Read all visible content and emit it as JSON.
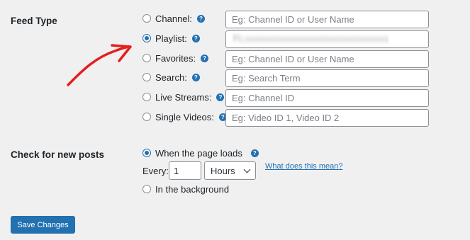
{
  "feed_type": {
    "label": "Feed Type",
    "options": [
      {
        "label": "Channel:",
        "placeholder": "Eg: Channel ID or User Name",
        "value": "",
        "checked": false
      },
      {
        "label": "Playlist:",
        "placeholder": "",
        "value": "PLxxxxxxxxxxxxxxxxxxxxxxxxxxxxx",
        "checked": true
      },
      {
        "label": "Favorites:",
        "placeholder": "Eg: Channel ID or User Name",
        "value": "",
        "checked": false
      },
      {
        "label": "Search:",
        "placeholder": "Eg: Search Term",
        "value": "",
        "checked": false
      },
      {
        "label": "Live Streams:",
        "placeholder": "Eg: Channel ID",
        "value": "",
        "checked": false
      },
      {
        "label": "Single Videos:",
        "placeholder": "Eg: Video ID 1, Video ID 2",
        "value": "",
        "checked": false
      }
    ]
  },
  "check_new_posts": {
    "label": "Check for new posts",
    "page_load": {
      "label": "When the page loads",
      "checked": true
    },
    "every_label": "Every:",
    "every_value": "1",
    "unit_selected": "Hours",
    "help_link": "What does this mean?",
    "background": {
      "label": "In the background",
      "checked": false
    }
  },
  "actions": {
    "save_label": "Save Changes"
  },
  "icons": {
    "help": "question-mark-help-icon",
    "annotation": "red-arrow-icon"
  },
  "colors": {
    "accent": "#2271b1",
    "arrow": "#e51e1e",
    "background": "#f0f0f1"
  }
}
